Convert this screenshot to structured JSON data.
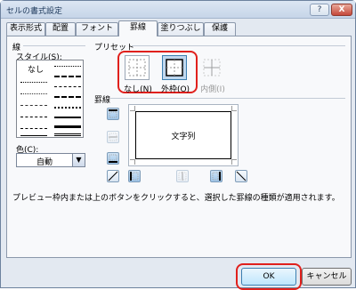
{
  "window": {
    "title": "セルの書式設定",
    "help_label": "?",
    "close_label": "X"
  },
  "tabs": [
    {
      "label": "表示形式",
      "active": false
    },
    {
      "label": "配置",
      "active": false
    },
    {
      "label": "フォント",
      "active": false
    },
    {
      "label": "罫線",
      "active": true
    },
    {
      "label": "塗りつぶし",
      "active": false
    },
    {
      "label": "保護",
      "active": false
    }
  ],
  "line_group": {
    "title": "線",
    "style_label": "スタイル(S):",
    "none_label": "なし",
    "color_label": "色(C):",
    "color_value": "自動",
    "dropdown_glyph": "▼"
  },
  "preset_group": {
    "title": "プリセット",
    "none_label": "なし(N)",
    "outline_label": "外枠(O)",
    "inside_label": "内側(I)"
  },
  "border_group": {
    "title": "罫線",
    "preview_text": "文字列"
  },
  "note": "プレビュー枠内または上のボタンをクリックすると、選択した罫線の種類が適用されます。",
  "buttons": {
    "ok": "OK",
    "cancel": "キャンセル"
  },
  "colors": {
    "highlight": "#e0201c",
    "accent": "#3c7fb1"
  }
}
